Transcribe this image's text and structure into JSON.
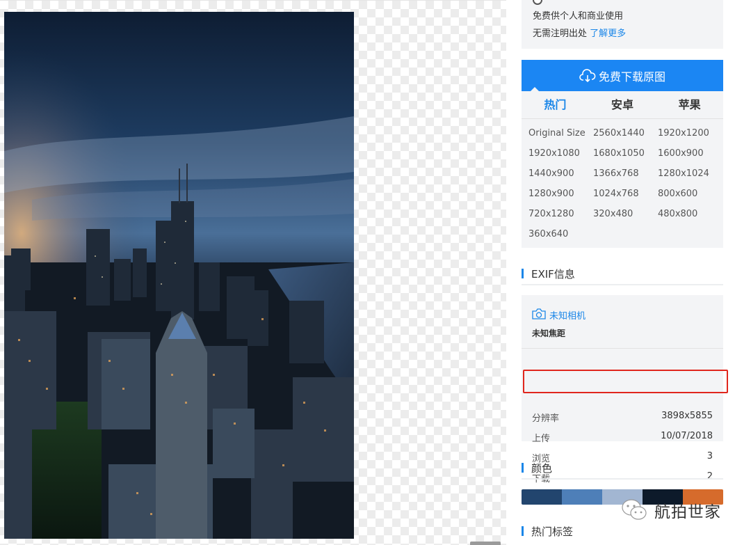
{
  "license": {
    "line1": "免费供个人和商业使用",
    "line2_prefix": "无需注明出处",
    "line2_link": "了解更多"
  },
  "download": {
    "label": "免费下载原图",
    "icon": "cloud-download-icon"
  },
  "resolution_tabs": [
    {
      "label": "热门",
      "active": true
    },
    {
      "label": "安卓",
      "active": false
    },
    {
      "label": "苹果",
      "active": false
    }
  ],
  "resolutions": [
    "Original Size",
    "2560x1440",
    "1920x1200",
    "1920x1080",
    "1680x1050",
    "1600x900",
    "1440x900",
    "1366x768",
    "1280x1024",
    "1280x900",
    "1024x768",
    "800x600",
    "720x1280",
    "320x480",
    "480x800",
    "360x640"
  ],
  "exif": {
    "section_title": "EXIF信息",
    "camera": "未知相机",
    "camera_icon": "camera-icon",
    "focal": "未知焦距",
    "rows": [
      {
        "key": "分辨率",
        "value": "3898x5855"
      },
      {
        "key": "上传",
        "value": "10/07/2018"
      },
      {
        "key": "浏览",
        "value": "3"
      },
      {
        "key": "下载",
        "value": "2"
      }
    ]
  },
  "colors": {
    "section_title": "颜色",
    "swatches": [
      "#22456e",
      "#4e7fb8",
      "#a2b6d2",
      "#0d1a2a",
      "#d66b2c"
    ]
  },
  "tags": {
    "section_title": "热门标签"
  },
  "watermark": {
    "text": "航拍世家",
    "icon": "wechat-icon"
  },
  "accent_color": "#1b86f3"
}
